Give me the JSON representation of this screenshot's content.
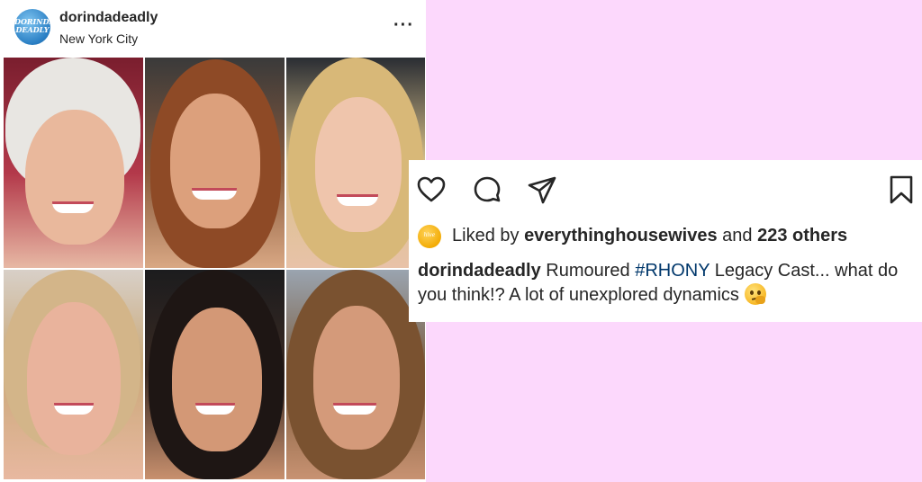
{
  "post": {
    "username": "dorindadeadly",
    "location": "New York City",
    "avatar_text": "DORINDA DEADLY",
    "more_icon": "more-horizontal-icon",
    "photos": [
      {
        "position": "top-left"
      },
      {
        "position": "top-middle"
      },
      {
        "position": "top-right"
      },
      {
        "position": "bottom-left"
      },
      {
        "position": "bottom-middle"
      },
      {
        "position": "bottom-right"
      }
    ]
  },
  "actions": {
    "icons": [
      "heart-icon",
      "comment-icon",
      "share-icon",
      "bookmark-icon"
    ],
    "liker_avatar_text": "hive",
    "likes_prefix": "Liked by ",
    "likes_user": "everythinghousewives",
    "likes_middle": " and ",
    "likes_count": "223 others"
  },
  "caption": {
    "username": "dorindadeadly",
    "text_before": " Rumoured ",
    "hashtag": "#RHONY",
    "text_after": " Legacy Cast... what do you think!? A lot of unexplored dynamics",
    "emoji": "thinking-face-icon"
  },
  "colors": {
    "background": "#fcd8fc",
    "text": "#262626",
    "hashtag": "#00376b"
  }
}
